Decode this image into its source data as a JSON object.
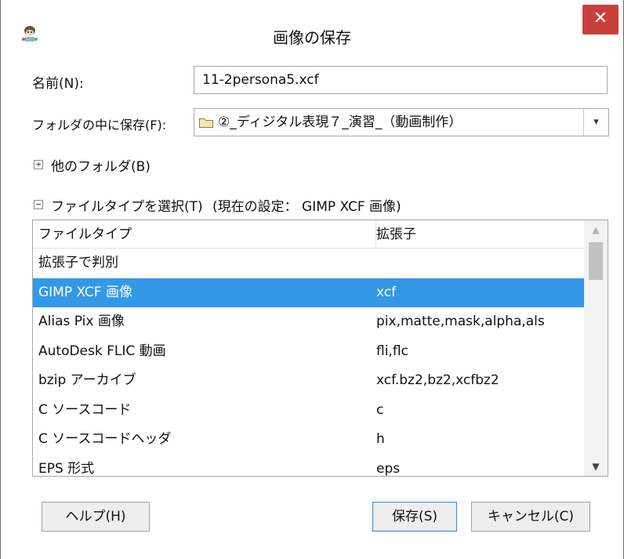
{
  "window": {
    "title": "画像の保存",
    "close_glyph": "✕",
    "icon": "gimp-mascot-icon"
  },
  "name_field": {
    "label": "名前(N):",
    "value": "11-2persona5.xcf"
  },
  "folder_field": {
    "label": "フォルダの中に保存(F):",
    "value": "②_ディジタル表現７_演習_（動画制作）",
    "arrow": "⌄"
  },
  "other_folders": {
    "expander": "+",
    "label": "他のフォルダ(B)"
  },
  "file_type_section": {
    "expander": "−",
    "label": "ファイルタイプを選択(T)",
    "current": "(現在の設定： GIMP XCF 画像)"
  },
  "file_type_list": {
    "columns": [
      "ファイルタイプ",
      "拡張子"
    ],
    "selected_index": 1,
    "rows": [
      {
        "type": "拡張子で判別",
        "ext": ""
      },
      {
        "type": "GIMP XCF 画像",
        "ext": "xcf"
      },
      {
        "type": "Alias Pix 画像",
        "ext": "pix,matte,mask,alpha,als"
      },
      {
        "type": "AutoDesk FLIC 動画",
        "ext": "fli,flc"
      },
      {
        "type": "bzip アーカイブ",
        "ext": "xcf.bz2,bz2,xcfbz2"
      },
      {
        "type": "C ソースコード",
        "ext": "c"
      },
      {
        "type": "C ソースコードヘッダ",
        "ext": "h"
      },
      {
        "type": "EPS 形式",
        "ext": "eps"
      }
    ],
    "scroll_up": "︿",
    "scroll_down": "﹀"
  },
  "buttons": {
    "help": "ヘルプ(H)",
    "save": "保存(S)",
    "cancel": "キャンセル(C)"
  }
}
